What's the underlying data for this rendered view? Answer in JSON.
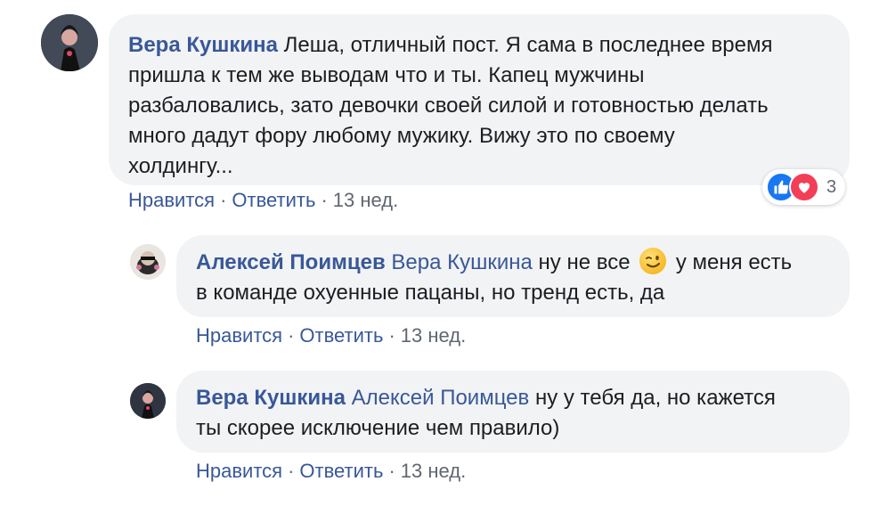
{
  "comments": [
    {
      "author": "Вера Кушкина",
      "mention": "",
      "lines": [
        "Леша, отличный пост. Я сама в последнее время",
        "пришла к тем же выводам что и ты. Капец мужчины",
        "разбаловались, зато девочки своей силой и готовностью делать",
        "много дадут фору любому мужику. Вижу это по своему",
        "холдингу..."
      ],
      "like_label": "Нравится",
      "reply_label": "Ответить",
      "time": "13 нед.",
      "reactions": {
        "icons": [
          "like-icon",
          "love-icon"
        ],
        "count": "3"
      }
    },
    {
      "author": "Алексей Поимцев",
      "mention": "Вера Кушкина",
      "line1_before_emoji": "ну не все",
      "emoji": "winking-face",
      "line1_after_emoji": "у меня есть",
      "line2": "в команде охуенные пацаны, но тренд есть, да",
      "like_label": "Нравится",
      "reply_label": "Ответить",
      "time": "13 нед."
    },
    {
      "author": "Вера Кушкина",
      "mention": "Алексей Поимцев",
      "line1": "ну у тебя да, но кажется",
      "line2": "ты скорее исключение чем правило)",
      "like_label": "Нравится",
      "reply_label": "Ответить",
      "time": "13 нед."
    }
  ],
  "colors": {
    "bubble_bg": "#f2f3f5",
    "link": "#385898",
    "meta": "#606770",
    "like_blue": "#1877f2",
    "love_red": "#f33e58"
  }
}
